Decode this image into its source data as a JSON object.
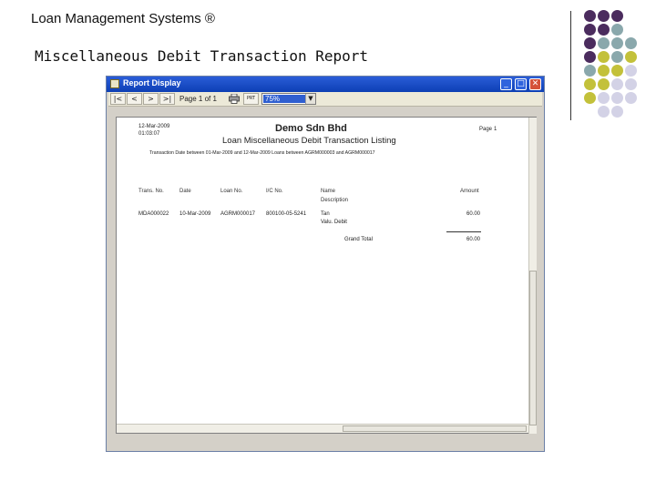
{
  "slide": {
    "title": "Loan Management Systems ®",
    "subtitle": "Miscellaneous Debit Transaction Report",
    "dot_colors": {
      "purple": "#4b2c5e",
      "teal": "#8aa8ac",
      "olive": "#c3c13a",
      "lavender": "#d3d2e6"
    }
  },
  "window": {
    "title": "Report Display",
    "buttons": {
      "minimize": "_",
      "maximize": "□",
      "close": "✕"
    }
  },
  "toolbar": {
    "first": "|<",
    "prev": "<",
    "next": ">",
    "last": ">|",
    "page_indicator": "Page 1 of 1",
    "print_label": "PRT",
    "zoom_value": "75%",
    "zoom_arrow": "▼"
  },
  "report": {
    "print_date": "12-Mar-2009",
    "print_time": "01:03:07",
    "company": "Demo Sdn Bhd",
    "page_label": "Page",
    "page_number": "1",
    "title": "Loan Miscellaneous Debit Transaction Listing",
    "filter": "Transaction Date between 01-Mar-2009 and 12-Mar-2009 Loans between AGRM000003 and AGRM000017",
    "columns": {
      "trans_no": "Trans. No.",
      "date": "Date",
      "loan_no": "Loan No.",
      "ic_no": "I/C No.",
      "name": "Name",
      "description": "Description",
      "amount": "Amount"
    },
    "rows": [
      {
        "trans_no": "MDA000022",
        "date": "10-Mar-2009",
        "loan_no": "AGRM000017",
        "ic_no": "800100-05-5241",
        "name": "Tan",
        "description": "Valu. Debit",
        "amount": "60.00"
      }
    ],
    "grand_total_label": "Grand Total",
    "grand_total": "60.00"
  }
}
